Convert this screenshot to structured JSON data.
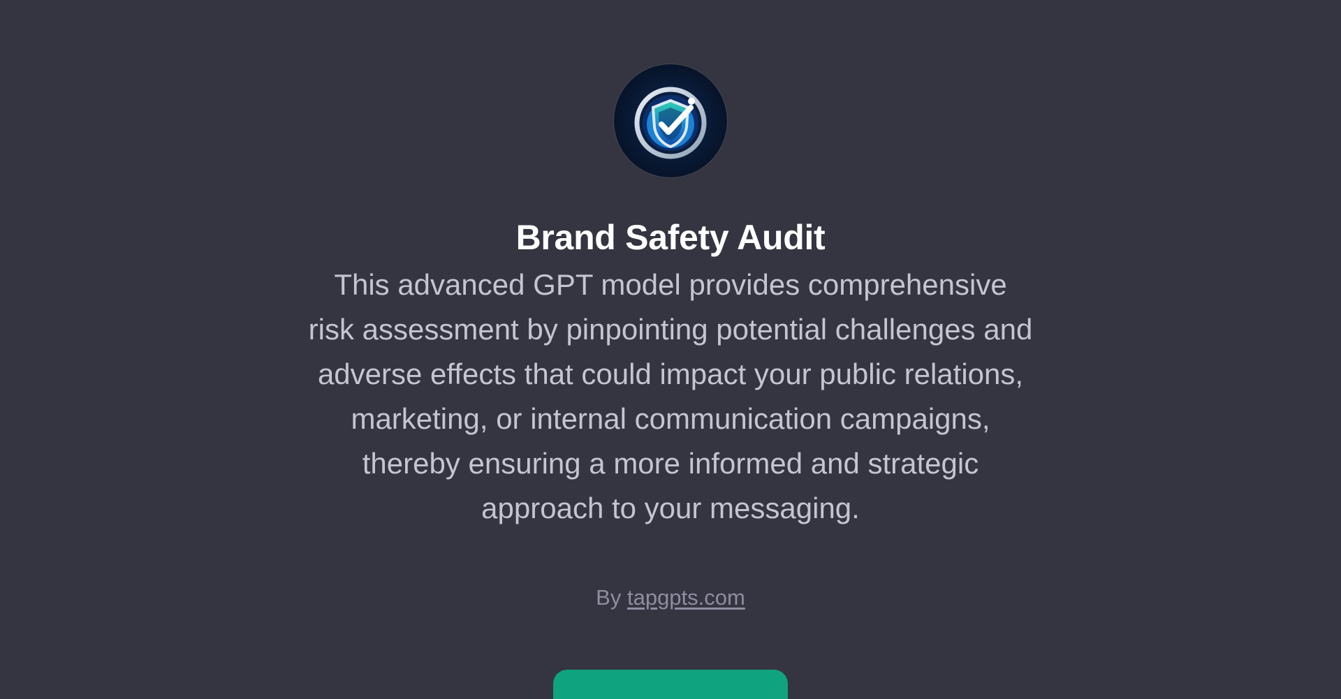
{
  "gpt": {
    "avatar_icon": "shield-check-icon",
    "name": "Brand Safety Audit",
    "description": "This advanced GPT model provides comprehensive risk assessment by pinpointing potential challenges and adverse effects that could impact your public relations, marketing, or internal communication campaigns, thereby ensuring a more informed and strategic approach to your messaging.",
    "author_prefix": "By",
    "author_link": "tapgpts.com"
  },
  "cta": {
    "label": "",
    "color": "#10a37f"
  },
  "colors": {
    "background": "#343541",
    "title": "#ffffff",
    "description": "#c5c5d2",
    "byline": "#8e8ea0"
  }
}
